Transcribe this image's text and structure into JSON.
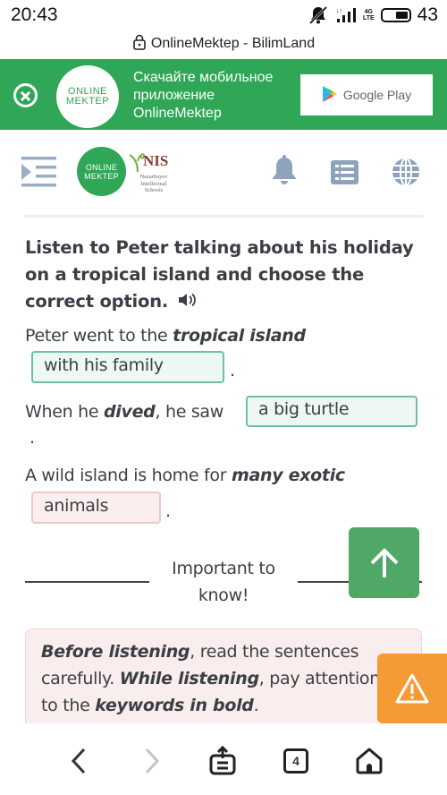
{
  "status_bar": {
    "time": "20:43",
    "network": "4G",
    "network_sub": "LTE",
    "battery": "43",
    "icons": [
      "mute-icon",
      "signal-icon",
      "battery-icon"
    ]
  },
  "url_bar": {
    "title": "OnlineMektep - BilimLand",
    "icon": "lock-icon"
  },
  "banner": {
    "logo_line1": "ONLINE",
    "logo_line2": "MEKTEP",
    "text": "Скачайте мобильное приложение OnlineMektep",
    "store_label": "Google Play",
    "background": "#2fa756"
  },
  "header": {
    "logo_line1": "ONLINE",
    "logo_line2": "MEKTEP",
    "nis_title": "NIS",
    "nis_subtitle": "Nazarbayev Intellectual Schools",
    "icons": [
      "menu-icon",
      "bell-icon",
      "list-icon",
      "globe-icon"
    ]
  },
  "task": {
    "title": "Listen to Peter talking about his holiday on a tropical island and choose the correct option.",
    "sentences": [
      {
        "before": "Peter went to the ",
        "keyword": "tropical island",
        "after": "",
        "answer": "with his family",
        "status": "correct",
        "end": "."
      },
      {
        "before": "When he ",
        "keyword": "dived",
        "after": ", he saw",
        "answer": "a big turtle",
        "status": "correct",
        "end": "."
      },
      {
        "before": "A wild island is home for ",
        "keyword": "many exotic",
        "after": "",
        "answer": "animals",
        "status": "incorrect",
        "end": "."
      }
    ]
  },
  "important": {
    "label": "Important to know!",
    "tip": {
      "k1": "Before listening",
      "t1": ", read the sentences",
      "t2": "carefully. ",
      "k2": "While listening",
      "t3": ", pay attention",
      "t4": "to the ",
      "k3": "keywords in bold",
      "t5": "."
    }
  },
  "floating": {
    "scroll_top_icon": "arrow-up-icon",
    "warning_icon": "warning-icon",
    "scroll_color": "#4fa865",
    "warning_color": "#f59a35"
  },
  "bottom_nav": {
    "tab_count": "4",
    "items": [
      "back",
      "forward",
      "share",
      "tabs",
      "home"
    ]
  }
}
